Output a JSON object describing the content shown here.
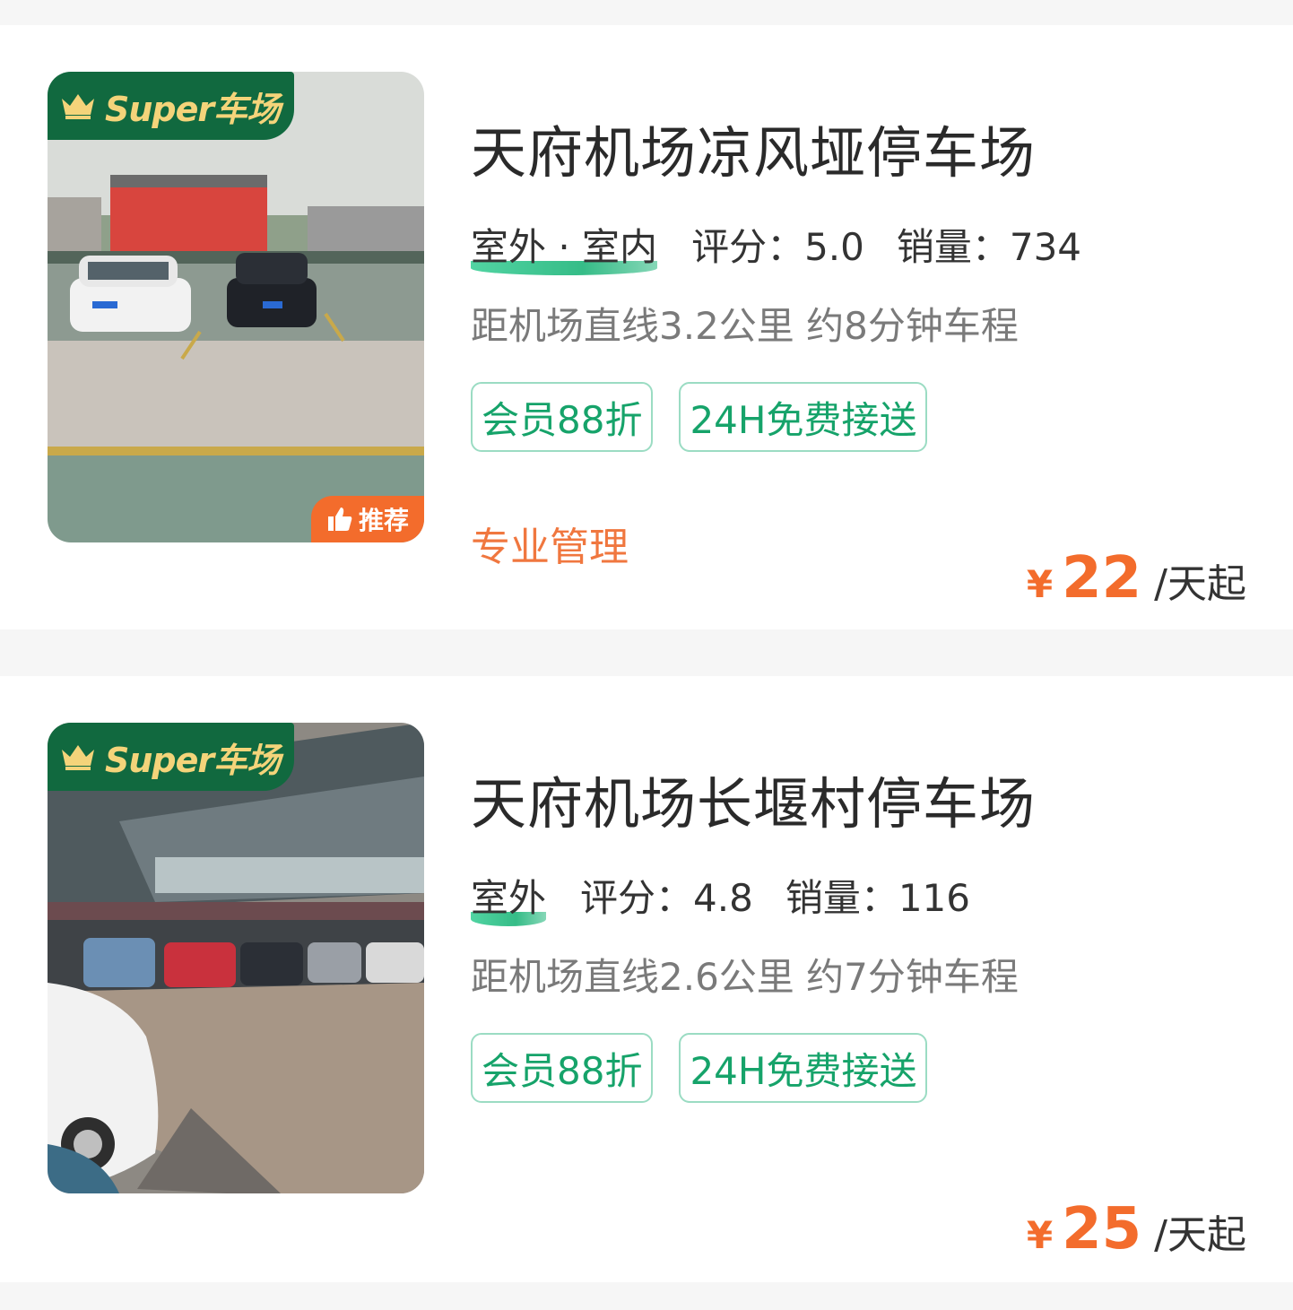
{
  "listings": [
    {
      "badge": "Super车场",
      "recommend": "推荐",
      "title": "天府机场凉风垭停车场",
      "type": "室外 · 室内",
      "rating": "评分：5.0",
      "sales": "销量：734",
      "distance": "距机场直线3.2公里 约8分钟车程",
      "tags": [
        "会员88折",
        "24H免费接送"
      ],
      "feature": "专业管理",
      "price_symbol": "¥",
      "price": "22",
      "price_unit": "/天起"
    },
    {
      "badge": "Super车场",
      "title": "天府机场长堰村停车场",
      "type": "室外",
      "rating": "评分：4.8",
      "sales": "销量：116",
      "distance": "距机场直线2.6公里 约7分钟车程",
      "tags": [
        "会员88折",
        "24H免费接送"
      ],
      "price_symbol": "¥",
      "price": "25",
      "price_unit": "/天起"
    }
  ],
  "colors": {
    "brand_green": "#11693f",
    "badge_gold": "#f4d47a",
    "tag_green": "#16a36a",
    "price_orange": "#f36c2c",
    "feature_orange": "#f0773f"
  }
}
